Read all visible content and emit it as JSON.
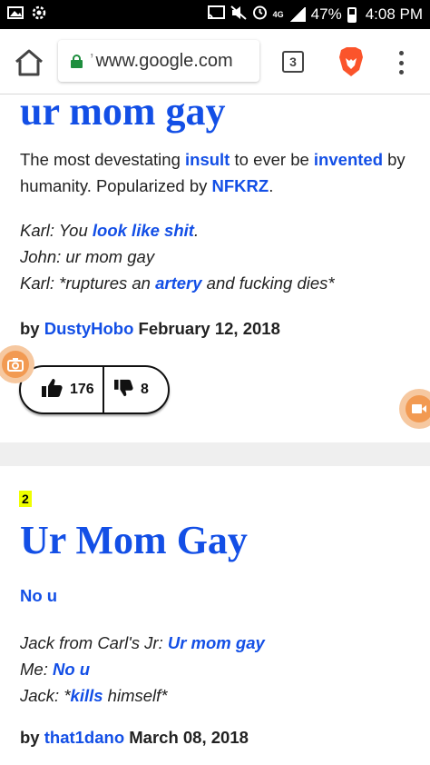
{
  "status_bar": {
    "battery": "47%",
    "time": "4:08 PM",
    "network": "4G",
    "battery_level": 0.47
  },
  "browser": {
    "url_prefix": "’",
    "url": "www.google.com",
    "tab_count": "3",
    "icons": {
      "home": "home-icon",
      "lock": "lock-icon",
      "brave": "brave-lion-icon",
      "menu": "more-vert-icon"
    }
  },
  "entries": [
    {
      "word": "ur mom gay",
      "meaning": {
        "t1": "The most devestating ",
        "l1": "insult",
        "t2": " to ever be ",
        "l2": "invented",
        "t3": " by humanity. Popularized by ",
        "l3": "NFKRZ",
        "t4": "."
      },
      "example": {
        "line1_a": "Karl: You ",
        "line1_link": "look like shit",
        "line1_b": ".",
        "line2": "John: ur mom gay",
        "line3_a": "Karl: *ruptures an ",
        "line3_link": "artery",
        "line3_b": " and fucking dies*"
      },
      "by": "by",
      "author": "DustyHobo",
      "date": "February 12, 2018",
      "upvotes": "176",
      "downvotes": "8"
    },
    {
      "rank": "2",
      "word": "Ur Mom Gay",
      "meaning_link": "No u",
      "example": {
        "line1_a": "Jack from Carl's Jr: ",
        "line1_link": "Ur mom gay",
        "line2_a": "Me: ",
        "line2_link": "No u",
        "line3_a": "Jack: *",
        "line3_link": "kills",
        "line3_b": " himself*"
      },
      "by": "by",
      "author": "that1dano",
      "date": "March 08, 2018"
    }
  ],
  "colors": {
    "link": "#134fe6",
    "rank_highlight": "#efff00",
    "floating_button": "#f29a52"
  }
}
